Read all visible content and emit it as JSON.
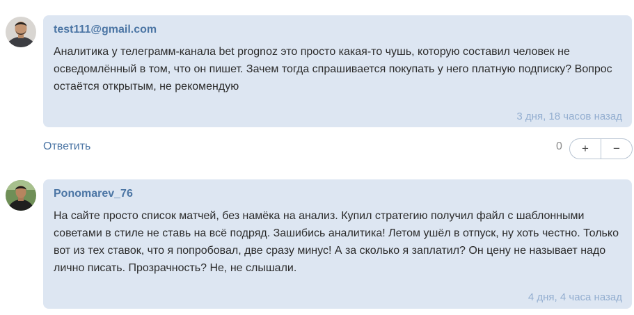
{
  "comments": [
    {
      "author": "test111@gmail.com",
      "text": "Аналитика у телеграмм-канала bet prognoz это просто какая-то чушь, которую составил человек не осведомлённый в том, что он пишет. Зачем тогда спрашивается покупать у него платную подписку? Вопрос остаётся открытым, не рекомендую",
      "time": "3 дня, 18 часов назад",
      "reply_label": "Ответить",
      "score": "0",
      "upvote_label": "+",
      "downvote_label": "−"
    },
    {
      "author": "Ponomarev_76",
      "text": "На сайте просто список матчей, без намёка на анализ. Купил стратегию получил файл с шаблонными советами в стиле не ставь на всё подряд. Зашибись аналитика! Летом ушёл в отпуск, ну хоть честно. Только вот из тех ставок, что я попробовал, две сразу минус! А за сколько я заплатил? Он цену не называет надо лично писать. Прозрачность? Не, не слышали.",
      "time": "4 дня, 4 часа назад"
    }
  ],
  "colors": {
    "bubble_bg": "#dde6f2",
    "author": "#4b75a4",
    "timestamp": "#93aed0",
    "body_text": "#2b2b2b"
  },
  "icons": {
    "avatar_1": "user-avatar-photo",
    "avatar_2": "user-avatar-photo"
  }
}
